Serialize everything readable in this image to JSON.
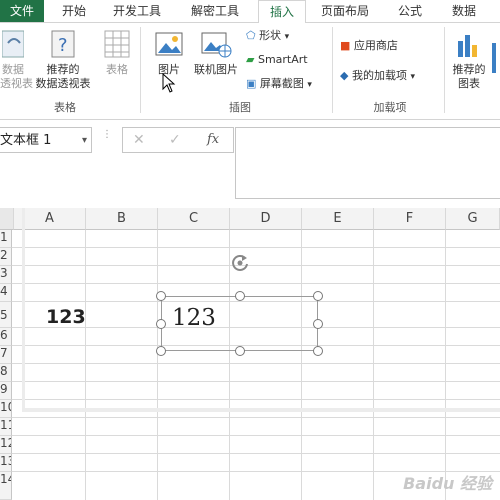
{
  "ribbon_tabs": [
    "文件",
    "开始",
    "开发工具",
    "解密工具",
    "插入",
    "页面布局",
    "公式",
    "数据"
  ],
  "ribbon": {
    "pivot_label": "数据\n透视表",
    "rec_pivot_label": "推荐的\n数据透视表",
    "table_label": "表格",
    "group_tables": "表格",
    "picture_label": "图片",
    "online_picture_label": "联机图片",
    "shapes_label": "形状",
    "smartart_label": "SmartArt",
    "screenshot_label": "屏幕截图",
    "group_illustrations": "插图",
    "store_label": "应用商店",
    "my_addins_label": "我的加载项",
    "group_addins": "加载项",
    "rec_charts_label": "推荐的\n图表"
  },
  "formula_bar": {
    "name_box": "文本框 1",
    "cancel": "✕",
    "enter": "✓",
    "fx": "fx",
    "content": ""
  },
  "columns": [
    "A",
    "B",
    "C",
    "D",
    "E",
    "F",
    "G"
  ],
  "rows": [
    "1",
    "2",
    "3",
    "4",
    "5",
    "6",
    "7",
    "8",
    "9",
    "10",
    "11",
    "12",
    "13",
    "14"
  ],
  "cell_a5": "123",
  "textbox_text": "123",
  "watermark": "Baidu 经验",
  "accent_color": "#217346"
}
